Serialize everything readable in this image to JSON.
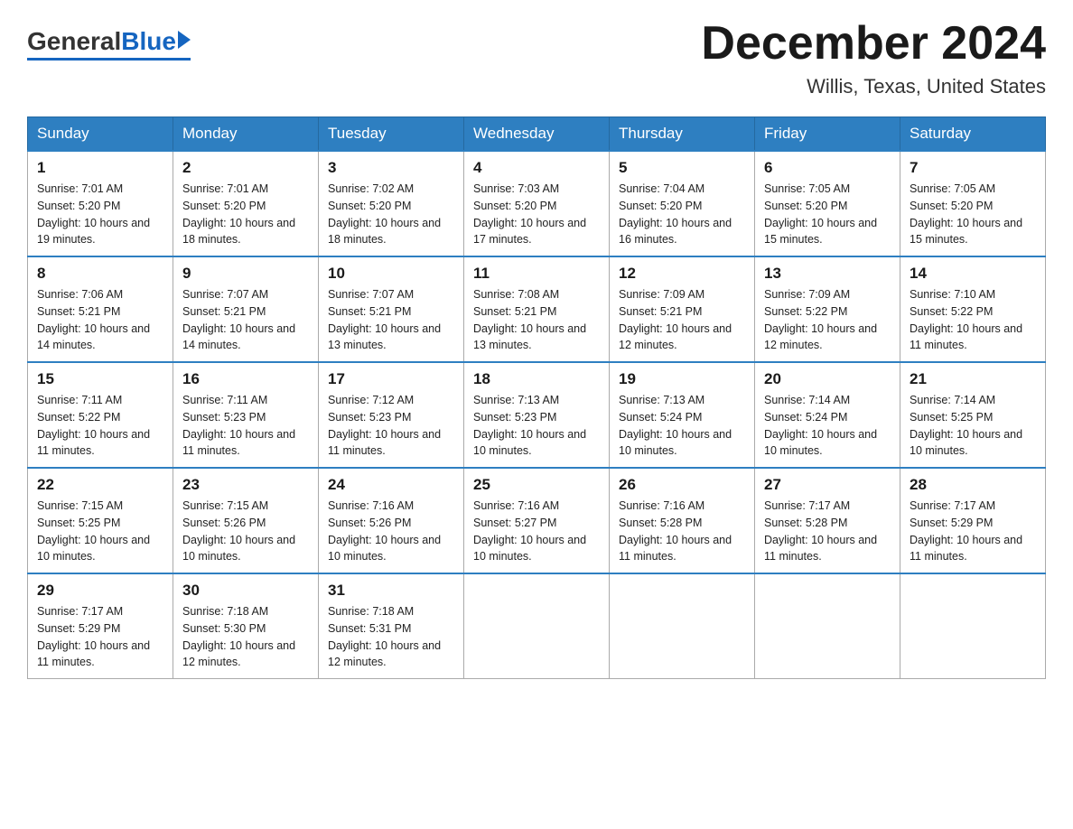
{
  "header": {
    "logo_general": "General",
    "logo_blue": "Blue",
    "month_title": "December 2024",
    "location": "Willis, Texas, United States"
  },
  "calendar": {
    "days_of_week": [
      "Sunday",
      "Monday",
      "Tuesday",
      "Wednesday",
      "Thursday",
      "Friday",
      "Saturday"
    ],
    "weeks": [
      [
        {
          "day": "1",
          "sunrise": "7:01 AM",
          "sunset": "5:20 PM",
          "daylight": "10 hours and 19 minutes."
        },
        {
          "day": "2",
          "sunrise": "7:01 AM",
          "sunset": "5:20 PM",
          "daylight": "10 hours and 18 minutes."
        },
        {
          "day": "3",
          "sunrise": "7:02 AM",
          "sunset": "5:20 PM",
          "daylight": "10 hours and 18 minutes."
        },
        {
          "day": "4",
          "sunrise": "7:03 AM",
          "sunset": "5:20 PM",
          "daylight": "10 hours and 17 minutes."
        },
        {
          "day": "5",
          "sunrise": "7:04 AM",
          "sunset": "5:20 PM",
          "daylight": "10 hours and 16 minutes."
        },
        {
          "day": "6",
          "sunrise": "7:05 AM",
          "sunset": "5:20 PM",
          "daylight": "10 hours and 15 minutes."
        },
        {
          "day": "7",
          "sunrise": "7:05 AM",
          "sunset": "5:20 PM",
          "daylight": "10 hours and 15 minutes."
        }
      ],
      [
        {
          "day": "8",
          "sunrise": "7:06 AM",
          "sunset": "5:21 PM",
          "daylight": "10 hours and 14 minutes."
        },
        {
          "day": "9",
          "sunrise": "7:07 AM",
          "sunset": "5:21 PM",
          "daylight": "10 hours and 14 minutes."
        },
        {
          "day": "10",
          "sunrise": "7:07 AM",
          "sunset": "5:21 PM",
          "daylight": "10 hours and 13 minutes."
        },
        {
          "day": "11",
          "sunrise": "7:08 AM",
          "sunset": "5:21 PM",
          "daylight": "10 hours and 13 minutes."
        },
        {
          "day": "12",
          "sunrise": "7:09 AM",
          "sunset": "5:21 PM",
          "daylight": "10 hours and 12 minutes."
        },
        {
          "day": "13",
          "sunrise": "7:09 AM",
          "sunset": "5:22 PM",
          "daylight": "10 hours and 12 minutes."
        },
        {
          "day": "14",
          "sunrise": "7:10 AM",
          "sunset": "5:22 PM",
          "daylight": "10 hours and 11 minutes."
        }
      ],
      [
        {
          "day": "15",
          "sunrise": "7:11 AM",
          "sunset": "5:22 PM",
          "daylight": "10 hours and 11 minutes."
        },
        {
          "day": "16",
          "sunrise": "7:11 AM",
          "sunset": "5:23 PM",
          "daylight": "10 hours and 11 minutes."
        },
        {
          "day": "17",
          "sunrise": "7:12 AM",
          "sunset": "5:23 PM",
          "daylight": "10 hours and 11 minutes."
        },
        {
          "day": "18",
          "sunrise": "7:13 AM",
          "sunset": "5:23 PM",
          "daylight": "10 hours and 10 minutes."
        },
        {
          "day": "19",
          "sunrise": "7:13 AM",
          "sunset": "5:24 PM",
          "daylight": "10 hours and 10 minutes."
        },
        {
          "day": "20",
          "sunrise": "7:14 AM",
          "sunset": "5:24 PM",
          "daylight": "10 hours and 10 minutes."
        },
        {
          "day": "21",
          "sunrise": "7:14 AM",
          "sunset": "5:25 PM",
          "daylight": "10 hours and 10 minutes."
        }
      ],
      [
        {
          "day": "22",
          "sunrise": "7:15 AM",
          "sunset": "5:25 PM",
          "daylight": "10 hours and 10 minutes."
        },
        {
          "day": "23",
          "sunrise": "7:15 AM",
          "sunset": "5:26 PM",
          "daylight": "10 hours and 10 minutes."
        },
        {
          "day": "24",
          "sunrise": "7:16 AM",
          "sunset": "5:26 PM",
          "daylight": "10 hours and 10 minutes."
        },
        {
          "day": "25",
          "sunrise": "7:16 AM",
          "sunset": "5:27 PM",
          "daylight": "10 hours and 10 minutes."
        },
        {
          "day": "26",
          "sunrise": "7:16 AM",
          "sunset": "5:28 PM",
          "daylight": "10 hours and 11 minutes."
        },
        {
          "day": "27",
          "sunrise": "7:17 AM",
          "sunset": "5:28 PM",
          "daylight": "10 hours and 11 minutes."
        },
        {
          "day": "28",
          "sunrise": "7:17 AM",
          "sunset": "5:29 PM",
          "daylight": "10 hours and 11 minutes."
        }
      ],
      [
        {
          "day": "29",
          "sunrise": "7:17 AM",
          "sunset": "5:29 PM",
          "daylight": "10 hours and 11 minutes."
        },
        {
          "day": "30",
          "sunrise": "7:18 AM",
          "sunset": "5:30 PM",
          "daylight": "10 hours and 12 minutes."
        },
        {
          "day": "31",
          "sunrise": "7:18 AM",
          "sunset": "5:31 PM",
          "daylight": "10 hours and 12 minutes."
        },
        null,
        null,
        null,
        null
      ]
    ]
  }
}
